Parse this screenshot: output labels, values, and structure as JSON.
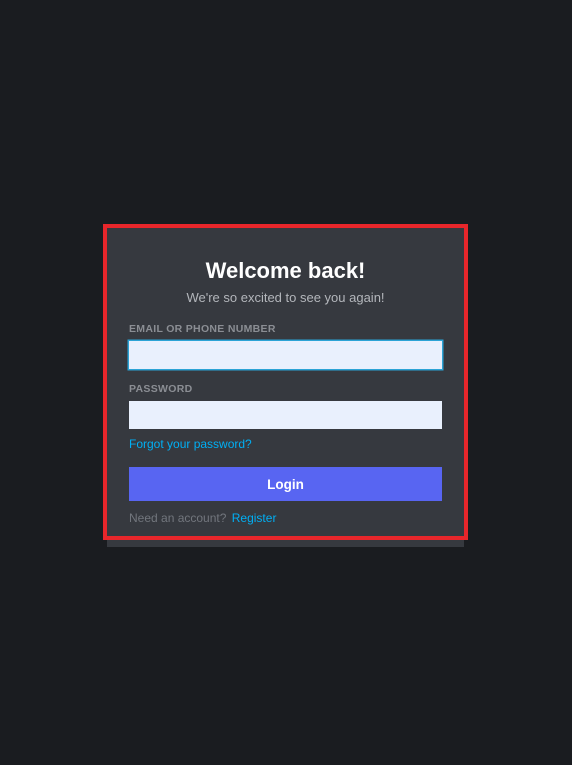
{
  "login": {
    "title": "Welcome back!",
    "subtitle": "We're so excited to see you again!",
    "email_label": "EMAIL OR PHONE NUMBER",
    "email_value": "",
    "password_label": "PASSWORD",
    "password_value": "",
    "forgot_link": "Forgot your password?",
    "login_button": "Login",
    "need_account_text": "Need an account?",
    "register_link": "Register"
  }
}
